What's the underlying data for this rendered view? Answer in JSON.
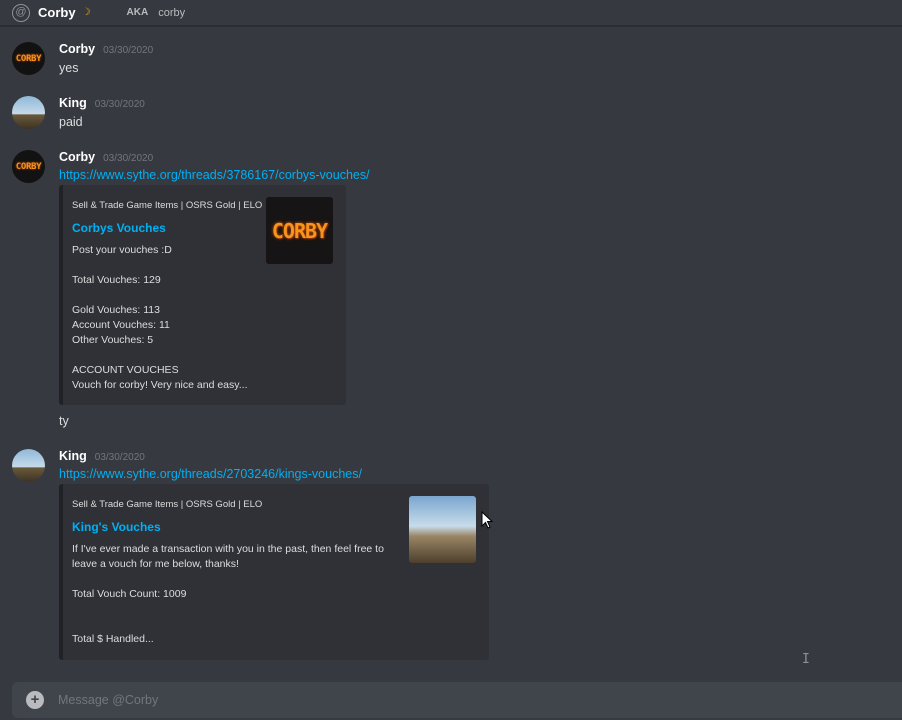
{
  "header": {
    "name": "Corby",
    "status_icon": "moon-icon",
    "aka_label": "AKA",
    "aka_name": "corby"
  },
  "messages": [
    {
      "author": "Corby",
      "timestamp": "03/30/2020",
      "text": "yes"
    },
    {
      "author": "King",
      "timestamp": "03/30/2020",
      "text": "paid"
    },
    {
      "author": "Corby",
      "timestamp": "03/30/2020",
      "link": "https://www.sythe.org/threads/3786167/corbys-vouches/",
      "embed": {
        "provider": "Sell & Trade Game Items | OSRS Gold | ELO",
        "title": "Corbys Vouches",
        "description": "Post your vouches :D\n\nTotal Vouches: 129\n\nGold Vouches: 113\nAccount Vouches: 11\nOther Vouches: 5\n\nACCOUNT VOUCHES\nVouch for corby! Very nice and easy...",
        "thumbnail_text": "CORBY"
      },
      "followup": "ty"
    },
    {
      "author": "King",
      "timestamp": "03/30/2020",
      "link": "https://www.sythe.org/threads/2703246/kings-vouches/",
      "embed": {
        "provider": "Sell & Trade Game Items | OSRS Gold | ELO",
        "title": "King's Vouches",
        "description": "If I've ever made a transaction with you in the past, then feel free to\nleave a vouch for me below, thanks!\n\nTotal Vouch Count: 1009\n\n\nTotal $ Handled..."
      }
    }
  ],
  "avatar_text": {
    "corby": "CORBY"
  },
  "composer": {
    "placeholder": "Message @Corby"
  },
  "colors": {
    "background": "#36393f",
    "link": "#00b0f4",
    "embed_bg": "#2f3136",
    "composer_bg": "#40444b",
    "status": "#faa61a"
  }
}
